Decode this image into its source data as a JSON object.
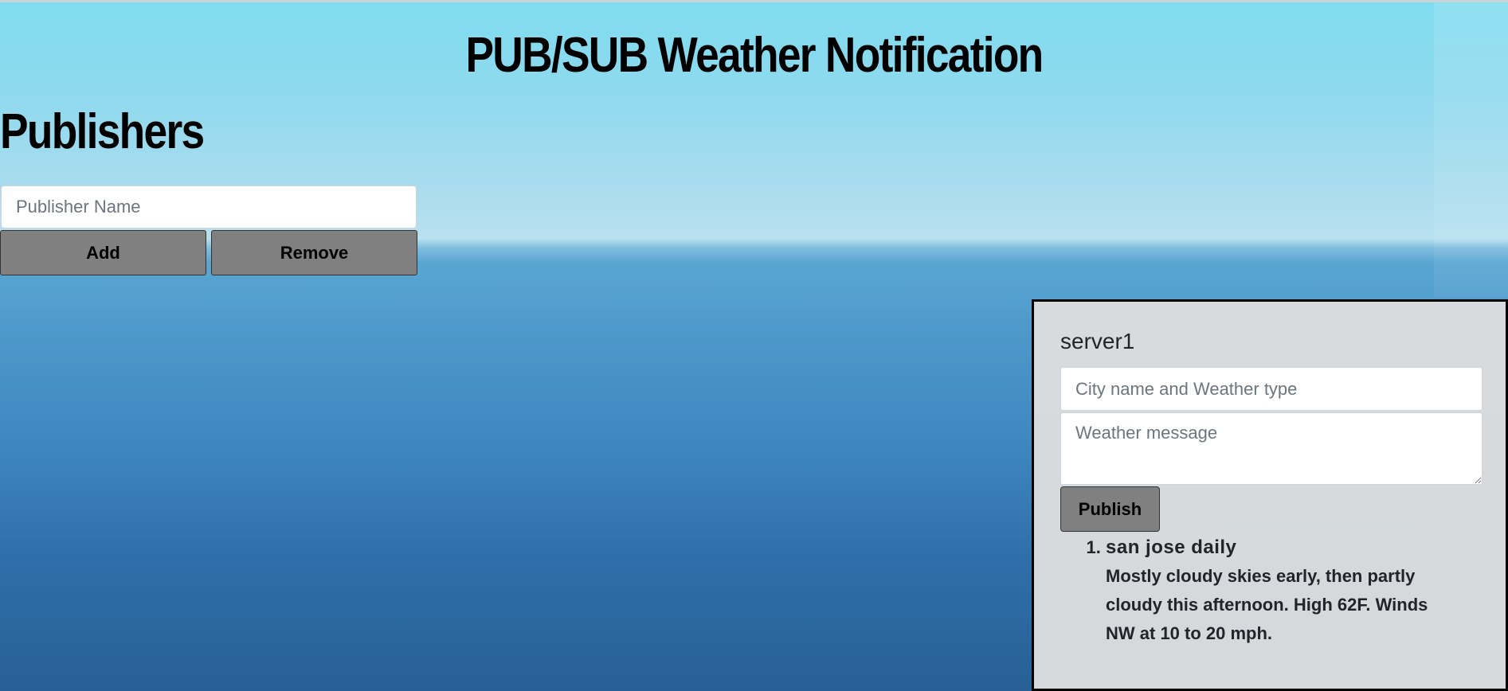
{
  "page": {
    "title": "PUB/SUB Weather Notification"
  },
  "publishers": {
    "heading": "Publishers",
    "name_placeholder": "Publisher Name",
    "add_label": "Add",
    "remove_label": "Remove"
  },
  "server_panel": {
    "name": "server1",
    "city_placeholder": "City name and Weather type",
    "message_placeholder": "Weather message",
    "publish_label": "Publish",
    "messages": [
      {
        "title": "san jose daily",
        "body": "Mostly cloudy skies early, then partly cloudy this afternoon. High 62F. Winds NW at 10 to 20 mph."
      }
    ]
  },
  "colors": {
    "button_bg": "#808080",
    "panel_bg": "#dedede",
    "panel_border": "#000000"
  }
}
